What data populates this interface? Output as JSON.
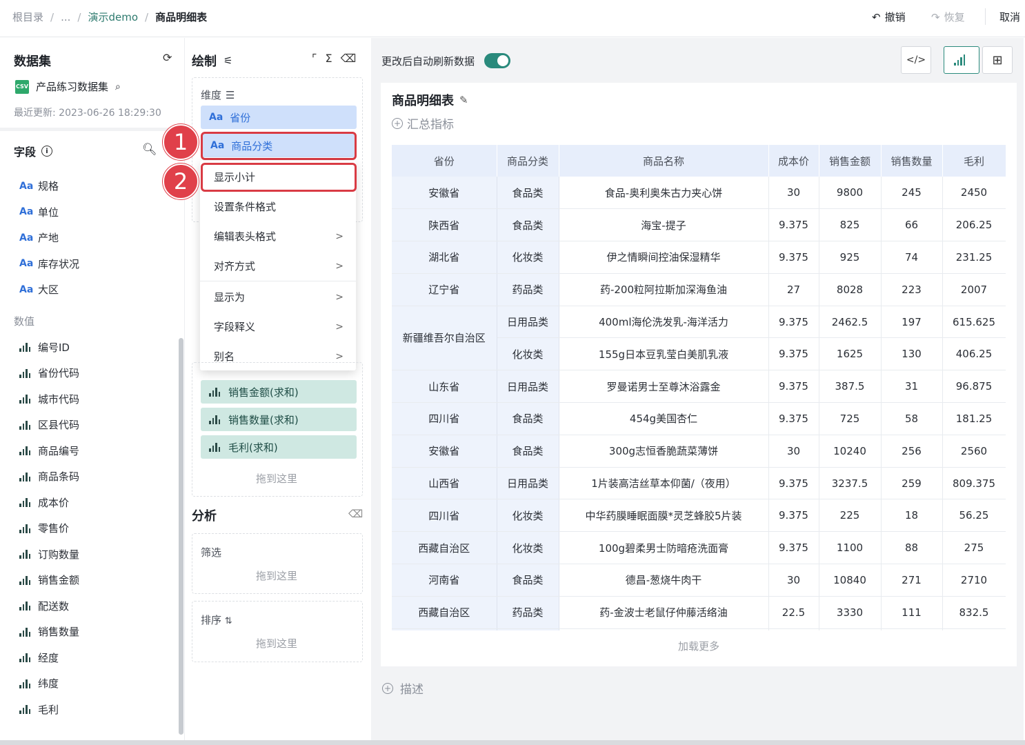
{
  "breadcrumb": {
    "root": "根目录",
    "ellipsis": "...",
    "folder": "演示demo",
    "current": "商品明细表"
  },
  "toolbar": {
    "undo": "撤销",
    "redo": "恢复",
    "cancel": "取消"
  },
  "dataset_panel": {
    "title": "数据集",
    "dataset_name": "产品练习数据集",
    "updated": "最近更新: 2023-06-26 18:29:30",
    "fields_title": "字段",
    "dimension_fields": [
      "规格",
      "单位",
      "产地",
      "库存状况",
      "大区"
    ],
    "value_section": "数值",
    "value_fields": [
      "编号ID",
      "省份代码",
      "城市代码",
      "区县代码",
      "商品编号",
      "商品条码",
      "成本价",
      "零售价",
      "订购数量",
      "销售金额",
      "配送数",
      "销售数量",
      "经度",
      "纬度",
      "毛利"
    ]
  },
  "draw_panel": {
    "title": "绘制",
    "dimension_label": "维度",
    "dim_chips": [
      "省份",
      "商品分类"
    ],
    "value_chips": [
      "销售金额(求和)",
      "销售数量(求和)",
      "毛利(求和)"
    ],
    "drop_hint": "拖到这里",
    "analysis_title": "分析",
    "filter_label": "筛选",
    "sort_label": "排序"
  },
  "context_menu": [
    {
      "label": "显示小计",
      "arrow": false
    },
    {
      "label": "设置条件格式",
      "arrow": false
    },
    {
      "label": "编辑表头格式",
      "arrow": true
    },
    {
      "label": "对齐方式",
      "arrow": true
    },
    {
      "label": "显示为",
      "arrow": true
    },
    {
      "label": "字段释义",
      "arrow": true
    },
    {
      "label": "别名",
      "arrow": true
    }
  ],
  "markers": [
    "1",
    "2"
  ],
  "canvas": {
    "auto_refresh": "更改后自动刷新数据",
    "auto_refresh_on": true,
    "card_title": "商品明细表",
    "summary": "汇总指标",
    "load_more": "加载更多",
    "describe": "描述"
  },
  "table": {
    "headers": [
      "省份",
      "商品分类",
      "商品名称",
      "成本价",
      "销售金额",
      "销售数量",
      "毛利"
    ],
    "rows": [
      [
        "安徽省",
        "食品类",
        "食品-奥利奥朱古力夹心饼",
        "30",
        "9800",
        "245",
        "2450"
      ],
      [
        "陕西省",
        "食品类",
        "海宝-提子",
        "9.375",
        "825",
        "66",
        "206.25"
      ],
      [
        "湖北省",
        "化妆类",
        "伊之情瞬间控油保湿精华",
        "9.375",
        "925",
        "74",
        "231.25"
      ],
      [
        "辽宁省",
        "药品类",
        "药-200粒阿拉斯加深海鱼油",
        "27",
        "8028",
        "223",
        "2007"
      ],
      [
        "新疆维吾尔自治区",
        "日用品类",
        "400ml海伦洗发乳-海洋活力",
        "9.375",
        "2462.5",
        "197",
        "615.625"
      ],
      [
        "",
        "化妆类",
        "155g日本豆乳莹白美肌乳液",
        "9.375",
        "1625",
        "130",
        "406.25"
      ],
      [
        "山东省",
        "日用品类",
        "罗曼诺男士至尊沐浴露金",
        "9.375",
        "387.5",
        "31",
        "96.875"
      ],
      [
        "四川省",
        "食品类",
        "454g美国杏仁",
        "9.375",
        "725",
        "58",
        "181.25"
      ],
      [
        "安徽省",
        "食品类",
        "300g志恒香脆蔬菜薄饼",
        "30",
        "10240",
        "256",
        "2560"
      ],
      [
        "山西省",
        "日用品类",
        "1片装高洁丝草本仰菌/（夜用）",
        "9.375",
        "3237.5",
        "259",
        "809.375"
      ],
      [
        "四川省",
        "化妆类",
        "中华药膜睡眠面膜*灵芝蜂胶5片装",
        "9.375",
        "225",
        "18",
        "56.25"
      ],
      [
        "西藏自治区",
        "化妆类",
        "100g碧柔男士防暗疮洗面膏",
        "9.375",
        "1100",
        "88",
        "275"
      ],
      [
        "河南省",
        "食品类",
        "德昌-葱烧牛肉干",
        "30",
        "10840",
        "271",
        "2710"
      ],
      [
        "西藏自治区",
        "药品类",
        "药-金波士老鼠仔仲藤活络油",
        "22.5",
        "3330",
        "111",
        "832.5"
      ],
      [
        "",
        "",
        "",
        "",
        "",
        "",
        ""
      ]
    ]
  },
  "colors": {
    "accent": "#2a8a7c",
    "highlight": "#d93b44",
    "dim_chip": "#cfe0fb",
    "value_chip": "#cfe8e2"
  }
}
